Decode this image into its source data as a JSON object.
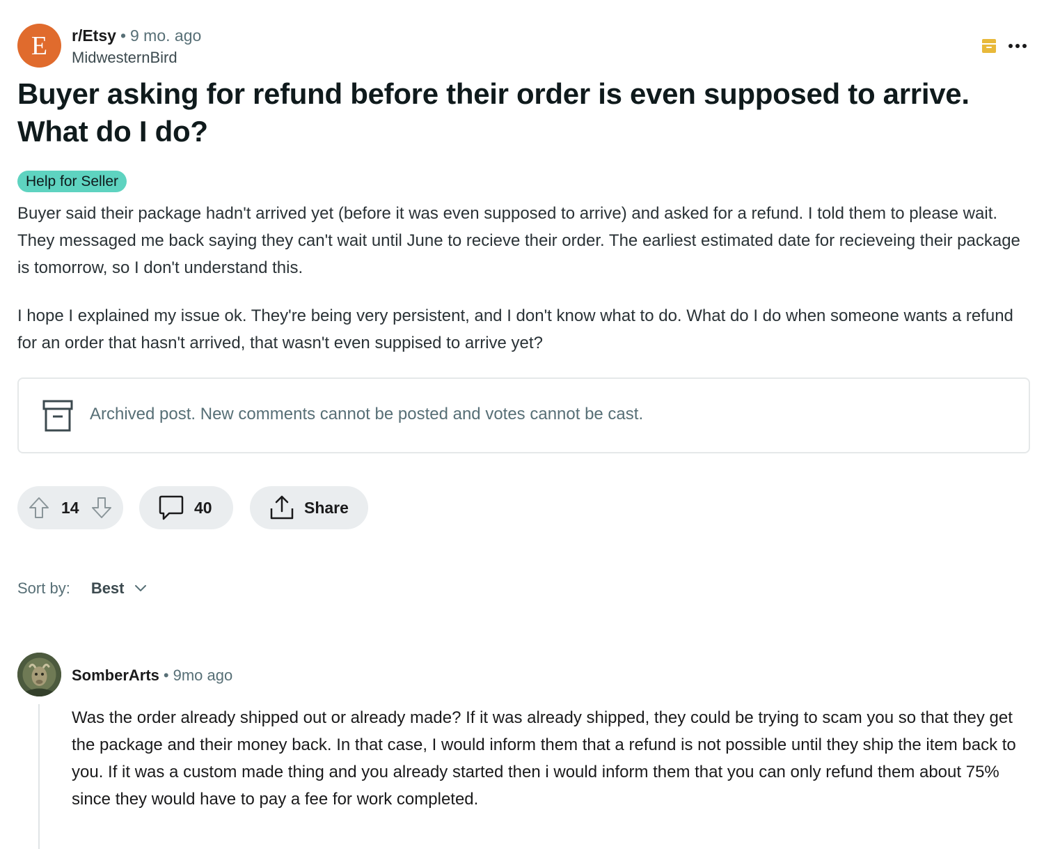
{
  "post": {
    "subreddit_avatar_letter": "E",
    "subreddit": "r/Etsy",
    "separator": "•",
    "time_ago": "9 mo. ago",
    "author": "MidwesternBird",
    "title": "Buyer asking for refund before their order is even supposed to arrive. What do I do?",
    "flair": "Help for Seller",
    "body": [
      "Buyer said their package hadn't arrived yet (before it was even supposed to arrive) and asked for a refund. I told them to please wait. They messaged me back saying they can't wait until June to recieve their order. The earliest estimated date for recieveing their package is tomorrow, so I don't understand this.",
      "I hope I explained my issue ok. They're being very persistent, and I don't know what to do. What do I do when someone wants a refund for an order that hasn't arrived, that wasn't even suppised to arrive yet?"
    ],
    "archived_notice": "Archived post. New comments cannot be posted and votes cannot be cast.",
    "vote_count": "14",
    "comment_count": "40",
    "share_label": "Share"
  },
  "sort": {
    "label": "Sort by:",
    "value": "Best"
  },
  "comments": [
    {
      "author": "SomberArts",
      "separator": "•",
      "time_ago": "9mo ago",
      "body": "Was the order already shipped out or already made? If it was already shipped, they could be trying to scam you so that they get the package and their money back. In that case, I would inform them that a refund is not possible until they ship the item back to you. If it was a custom made thing and you already started then i would inform them that you can only refund them about 75% since they would have to pay a fee for work completed."
    }
  ],
  "icons": {
    "save": "archive-save-icon",
    "more": "more-horizontal-icon",
    "archive": "archive-box-icon",
    "upvote": "upvote-arrow-icon",
    "downvote": "downvote-arrow-icon",
    "comment": "comment-bubble-icon",
    "share": "share-upload-icon",
    "chevron": "chevron-down-icon"
  },
  "colors": {
    "subreddit_avatar": "#e06b2d",
    "flair_bg": "#5ed3c0",
    "save_icon": "#e8b93a",
    "pill_bg": "#eaedef",
    "muted_text": "#576f76"
  }
}
